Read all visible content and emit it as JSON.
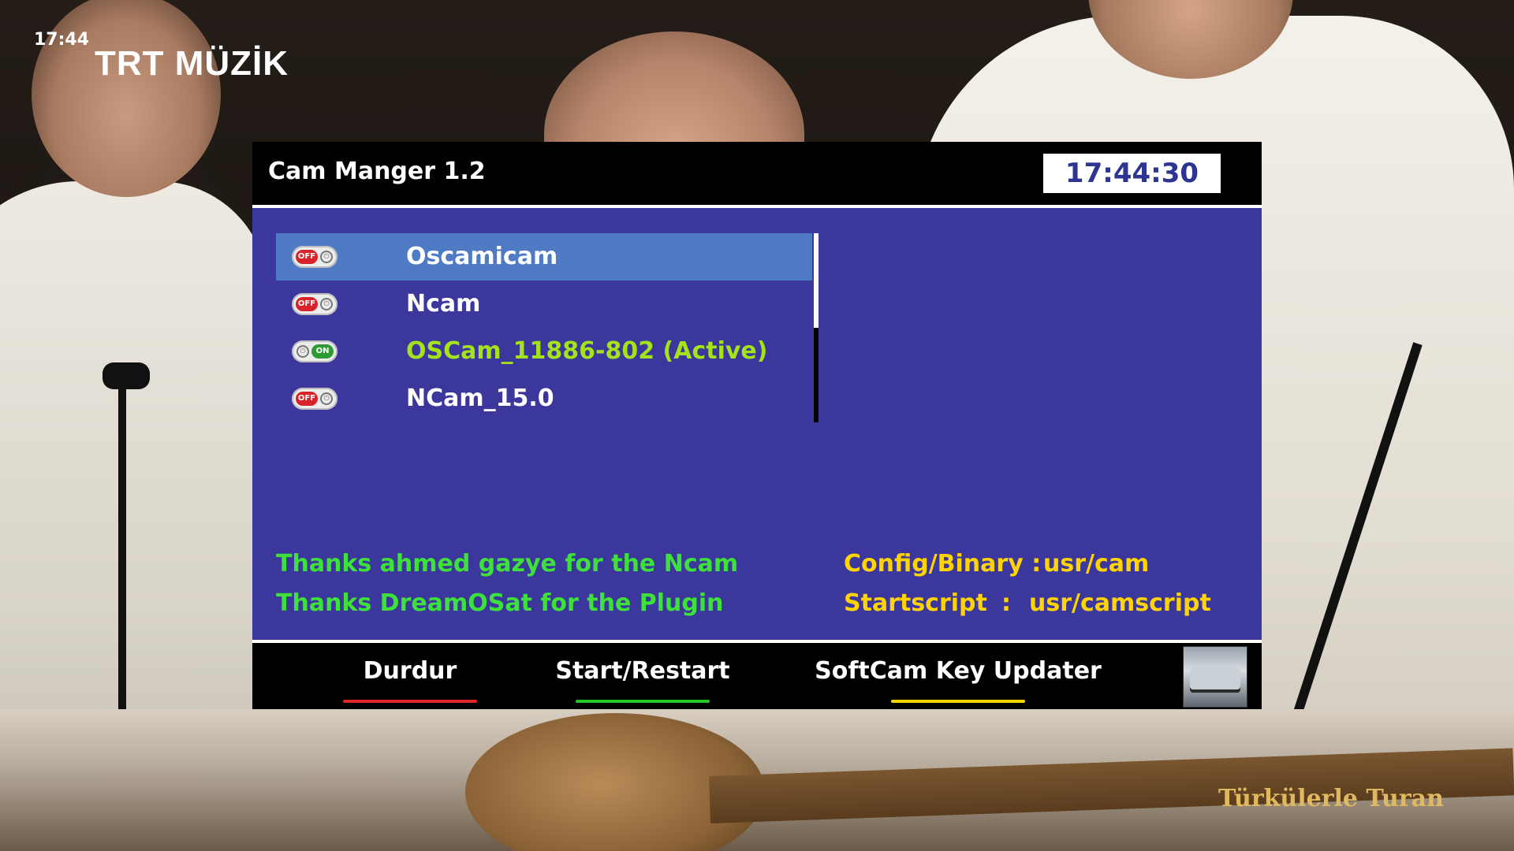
{
  "tv": {
    "clock": "17:44",
    "channel_logo": "TRT MÜZİK",
    "caption": "Türkülerle Turan"
  },
  "window": {
    "title": "Cam Manger 1.2",
    "clock": "17:44:30"
  },
  "cams": [
    {
      "label": "Oscamicam",
      "state": "OFF",
      "selected": true,
      "active": false
    },
    {
      "label": "Ncam",
      "state": "OFF",
      "selected": false,
      "active": false
    },
    {
      "label": "OSCam_11886-802  (Active)",
      "state": "ON",
      "selected": false,
      "active": true
    },
    {
      "label": "NCam_15.0",
      "state": "OFF",
      "selected": false,
      "active": false
    }
  ],
  "credits": {
    "line1": "Thanks  ahmed gazye for the Ncam",
    "line2": "Thanks  DreamOSat for the Plugin"
  },
  "paths": {
    "config_label": "Config/Binary :",
    "config_value": "usr/cam",
    "startscript_label": "Startscript",
    "startscript_sep": ":",
    "startscript_value": "usr/camscript"
  },
  "footer": {
    "red": "Durdur",
    "green": "Start/Restart",
    "yellow": "SoftCam Key Updater"
  },
  "colors": {
    "panel": "#3b379c",
    "selected_row": "#4f7ac4",
    "active_text": "#a4e21a",
    "credits_text": "#3ee03a",
    "info_text": "#ffd400",
    "red_key": "#e0262b",
    "green_key": "#27c427",
    "yellow_key": "#f0d600"
  }
}
